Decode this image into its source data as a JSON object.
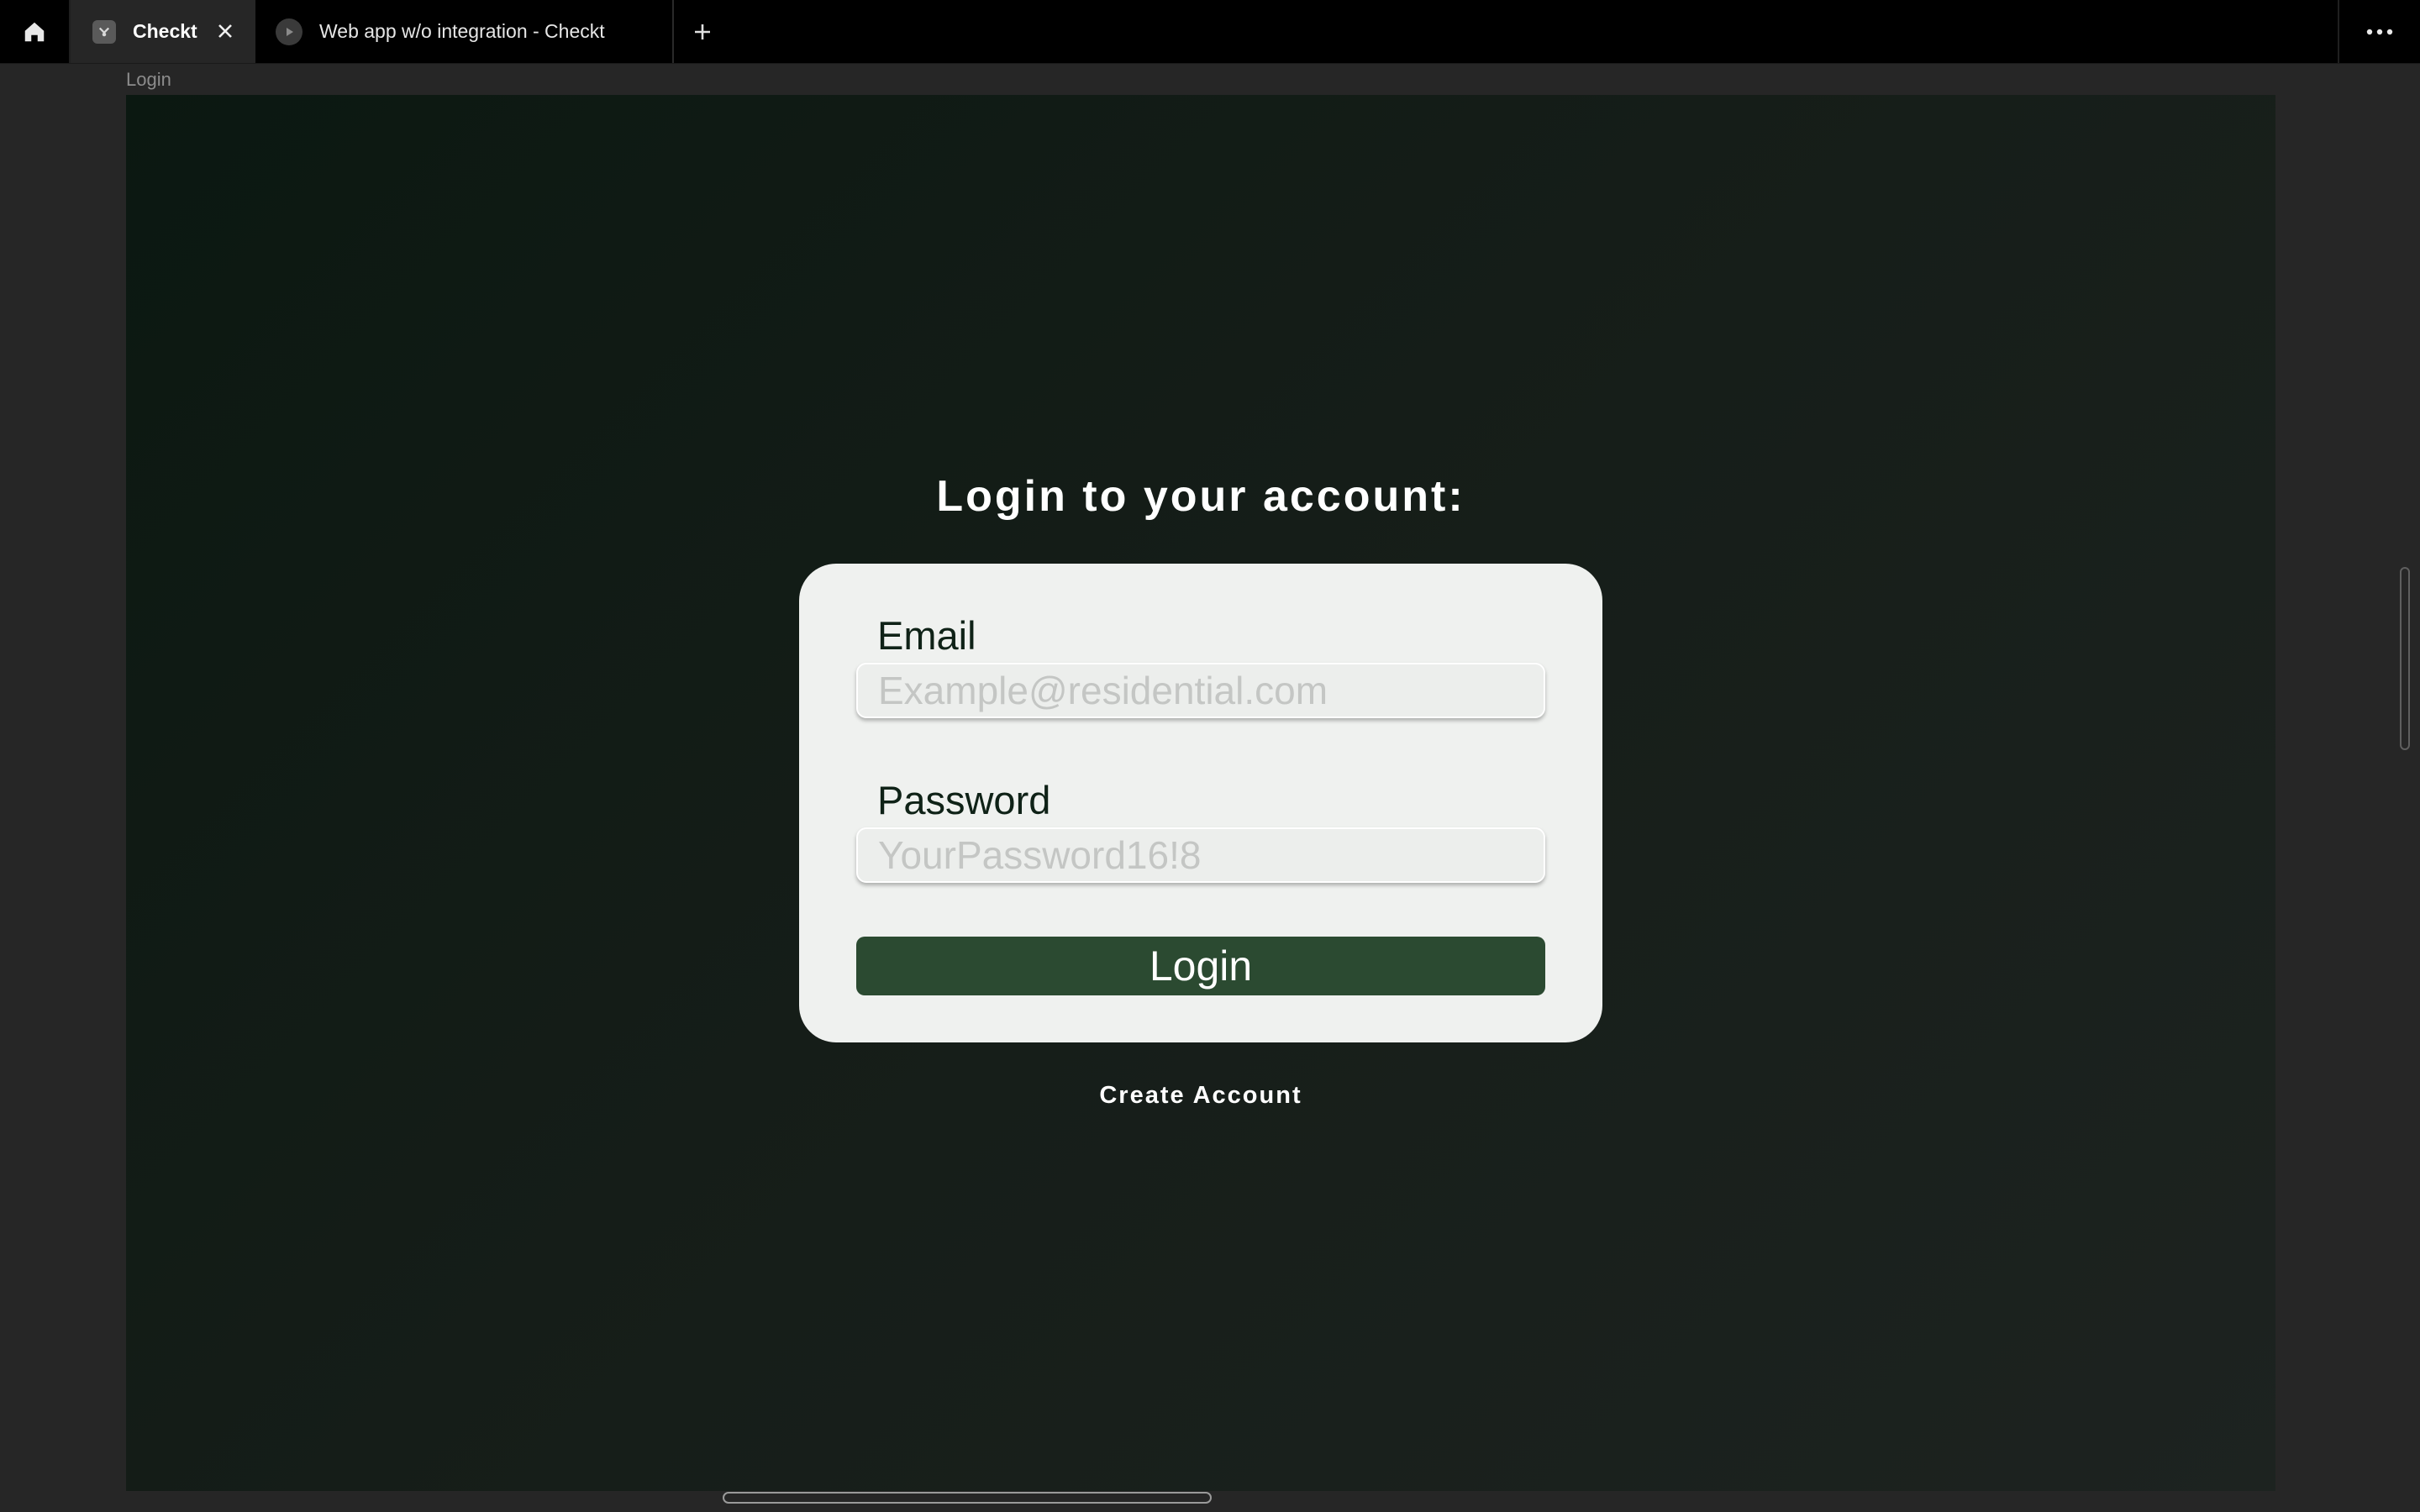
{
  "browser": {
    "tabs": [
      {
        "title": "Checkt",
        "active": true
      },
      {
        "title": "Web app w/o integration - Checkt",
        "active": false
      }
    ],
    "icons": {
      "home": "home-icon",
      "close": "close-icon",
      "new_tab": "plus-icon",
      "menu": "more-horizontal-icon",
      "play": "play-icon"
    }
  },
  "frame": {
    "label": "Login"
  },
  "login": {
    "heading": "Login to your account:",
    "email_label": "Email",
    "email_placeholder": "Example@residential.com",
    "email_value": "",
    "password_label": "Password",
    "password_placeholder": "YourPassword16!8",
    "password_value": "",
    "submit_label": "Login",
    "create_account_label": "Create Account"
  },
  "colors": {
    "background_dark": "#0b1811",
    "card": "#eff1ef",
    "primary_button": "#2b4a31",
    "label_text": "#0f2217"
  }
}
